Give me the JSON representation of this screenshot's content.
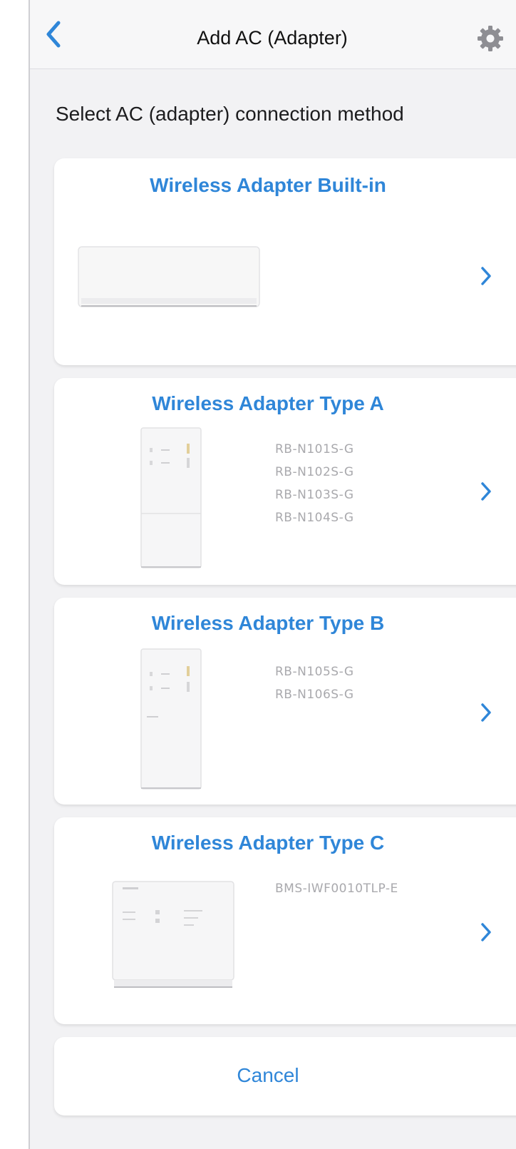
{
  "header": {
    "title": "Add AC (Adapter)",
    "back_icon": "chevron-left-icon",
    "settings_icon": "gear-icon"
  },
  "heading": "Select AC (adapter) connection method",
  "options": [
    {
      "title": "Wireless Adapter Built-in",
      "models": []
    },
    {
      "title": "Wireless Adapter Type A",
      "models": [
        "RB-N101S-G",
        "RB-N102S-G",
        "RB-N103S-G",
        "RB-N104S-G"
      ]
    },
    {
      "title": "Wireless Adapter Type B",
      "models": [
        "RB-N105S-G",
        "RB-N106S-G"
      ]
    },
    {
      "title": "Wireless Adapter Type C",
      "models": [
        "BMS-IWF0010TLP-E"
      ]
    }
  ],
  "cancel_label": "Cancel",
  "colors": {
    "accent": "#2f86d8",
    "background": "#f2f2f4",
    "model_text": "#a9a9ad"
  }
}
